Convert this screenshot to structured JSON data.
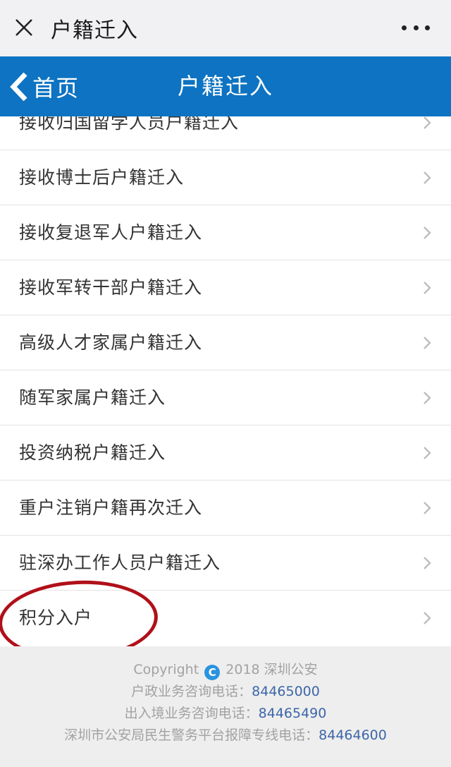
{
  "topbar": {
    "title": "户籍迁入"
  },
  "header": {
    "back_label": "首页",
    "title": "户籍迁入"
  },
  "list": {
    "items": [
      {
        "label": "接收归国留学人员户籍迁入"
      },
      {
        "label": "接收博士后户籍迁入"
      },
      {
        "label": "接收复退军人户籍迁入"
      },
      {
        "label": "接收军转干部户籍迁入"
      },
      {
        "label": "高级人才家属户籍迁入"
      },
      {
        "label": "随军家属户籍迁入"
      },
      {
        "label": "投资纳税户籍迁入"
      },
      {
        "label": "重户注销户籍再次迁入"
      },
      {
        "label": "驻深办工作人员户籍迁入"
      },
      {
        "label": "积分入户"
      }
    ]
  },
  "footer": {
    "copyright_prefix": "Copyright",
    "copyright_symbol": "C",
    "copyright_suffix": "2018 深圳公安",
    "lines": [
      {
        "label": "户政业务咨询电话：",
        "phone": "84465000"
      },
      {
        "label": "出入境业务咨询电话：",
        "phone": "84465490"
      },
      {
        "label": "深圳市公安局民生警务平台报障专线电话：",
        "phone": "84464600"
      }
    ]
  },
  "colors": {
    "header_blue": "#0d73c2",
    "annotation_red": "#b0101a",
    "phone_link": "#3c66a8"
  }
}
